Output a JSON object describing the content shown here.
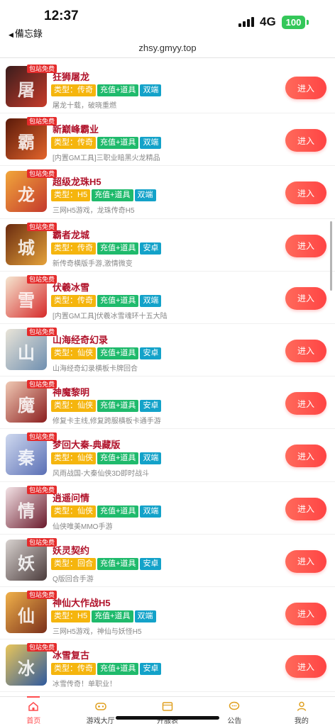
{
  "status": {
    "time": "12:37",
    "back_label": "備忘錄",
    "network": "4G",
    "battery": "100"
  },
  "url": "zhsy.gmyy.top",
  "enter_label": "进入",
  "free_badge": "包站免费",
  "games": [
    {
      "name": "狂狮屠龙",
      "type": "类型：传奇",
      "pay": "充值+道具",
      "platform": "双端",
      "desc": "屠龙十载，破晓重燃",
      "colors": [
        "#3a1d1d",
        "#c73b2a"
      ]
    },
    {
      "name": "新巅峰霸业",
      "type": "类型：传奇",
      "pay": "充值+道具",
      "platform": "双端",
      "desc": "[内置GM工具]三职业暗黑火龙精品",
      "colors": [
        "#5a1a0a",
        "#e3642b"
      ]
    },
    {
      "name": "超级龙珠H5",
      "type": "类型：H5",
      "pay": "充值+道具",
      "platform": "双端",
      "desc": "三网H5游戏，龙珠传奇H5",
      "colors": [
        "#f1a63b",
        "#c4392c"
      ]
    },
    {
      "name": "霸者龙城",
      "type": "类型：传奇",
      "pay": "充值+道具",
      "platform": "安卓",
      "desc": "新传奇横版手游,激情微变",
      "colors": [
        "#6a2b10",
        "#e5a23a"
      ]
    },
    {
      "name": "伏羲冰雪",
      "type": "类型：传奇",
      "pay": "充值+道具",
      "platform": "双端",
      "desc": "[内置GM工具]伏羲冰雪魂环十五大陆",
      "colors": [
        "#f5e6d0",
        "#d62a2a"
      ]
    },
    {
      "name": "山海经奇幻录",
      "type": "类型：仙侠",
      "pay": "充值+道具",
      "platform": "安卓",
      "desc": "山海经奇幻录横板卡牌回合",
      "colors": [
        "#e9e4d8",
        "#6f8fb0"
      ]
    },
    {
      "name": "神魔黎明",
      "type": "类型：仙侠",
      "pay": "充值+道具",
      "platform": "安卓",
      "desc": "修复卡主线,修复跨服横板卡通手游",
      "colors": [
        "#f0c9b4",
        "#8b1e1e"
      ]
    },
    {
      "name": "梦回大秦-典藏版",
      "type": "类型：仙侠",
      "pay": "充值+道具",
      "platform": "双端",
      "desc": "风雨战国-大秦仙侠3D即时战斗",
      "colors": [
        "#cfd9ef",
        "#5a6fb5"
      ]
    },
    {
      "name": "逍遥问情",
      "type": "类型：仙侠",
      "pay": "充值+道具",
      "platform": "双端",
      "desc": "仙侠唯美MMO手游",
      "colors": [
        "#f3e3e6",
        "#6a1a2c"
      ]
    },
    {
      "name": "妖灵契约",
      "type": "类型：回合",
      "pay": "充值+道具",
      "platform": "安卓",
      "desc": "Q版回合手游",
      "colors": [
        "#d8d2cf",
        "#4a3b3b"
      ]
    },
    {
      "name": "神仙大作战H5",
      "type": "类型：H5",
      "pay": "充值+道具",
      "platform": "双端",
      "desc": "三网H5游戏，神仙与妖怪H5",
      "colors": [
        "#f0b14a",
        "#7a2f1a"
      ]
    },
    {
      "name": "冰雪复古",
      "type": "类型：传奇",
      "pay": "充值+道具",
      "platform": "安卓",
      "desc": "冰雪传奇！单职业！",
      "colors": [
        "#e8c55a",
        "#2f5a9e"
      ]
    }
  ],
  "tabs": [
    {
      "label": "首页",
      "icon": "home-icon"
    },
    {
      "label": "游戏大厅",
      "icon": "gamepad-icon"
    },
    {
      "label": "开服表",
      "icon": "calendar-icon"
    },
    {
      "label": "公告",
      "icon": "chat-icon"
    },
    {
      "label": "我的",
      "icon": "user-icon"
    }
  ]
}
